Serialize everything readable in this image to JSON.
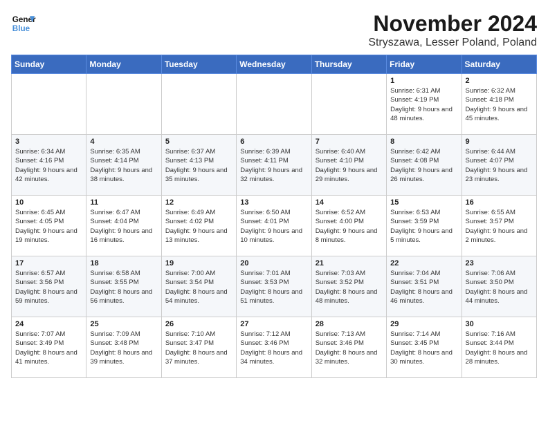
{
  "header": {
    "logo_line1": "General",
    "logo_line2": "Blue",
    "month_title": "November 2024",
    "location": "Stryszawa, Lesser Poland, Poland"
  },
  "weekdays": [
    "Sunday",
    "Monday",
    "Tuesday",
    "Wednesday",
    "Thursday",
    "Friday",
    "Saturday"
  ],
  "weeks": [
    [
      {
        "day": "",
        "content": ""
      },
      {
        "day": "",
        "content": ""
      },
      {
        "day": "",
        "content": ""
      },
      {
        "day": "",
        "content": ""
      },
      {
        "day": "",
        "content": ""
      },
      {
        "day": "1",
        "content": "Sunrise: 6:31 AM\nSunset: 4:19 PM\nDaylight: 9 hours\nand 48 minutes."
      },
      {
        "day": "2",
        "content": "Sunrise: 6:32 AM\nSunset: 4:18 PM\nDaylight: 9 hours\nand 45 minutes."
      }
    ],
    [
      {
        "day": "3",
        "content": "Sunrise: 6:34 AM\nSunset: 4:16 PM\nDaylight: 9 hours\nand 42 minutes."
      },
      {
        "day": "4",
        "content": "Sunrise: 6:35 AM\nSunset: 4:14 PM\nDaylight: 9 hours\nand 38 minutes."
      },
      {
        "day": "5",
        "content": "Sunrise: 6:37 AM\nSunset: 4:13 PM\nDaylight: 9 hours\nand 35 minutes."
      },
      {
        "day": "6",
        "content": "Sunrise: 6:39 AM\nSunset: 4:11 PM\nDaylight: 9 hours\nand 32 minutes."
      },
      {
        "day": "7",
        "content": "Sunrise: 6:40 AM\nSunset: 4:10 PM\nDaylight: 9 hours\nand 29 minutes."
      },
      {
        "day": "8",
        "content": "Sunrise: 6:42 AM\nSunset: 4:08 PM\nDaylight: 9 hours\nand 26 minutes."
      },
      {
        "day": "9",
        "content": "Sunrise: 6:44 AM\nSunset: 4:07 PM\nDaylight: 9 hours\nand 23 minutes."
      }
    ],
    [
      {
        "day": "10",
        "content": "Sunrise: 6:45 AM\nSunset: 4:05 PM\nDaylight: 9 hours\nand 19 minutes."
      },
      {
        "day": "11",
        "content": "Sunrise: 6:47 AM\nSunset: 4:04 PM\nDaylight: 9 hours\nand 16 minutes."
      },
      {
        "day": "12",
        "content": "Sunrise: 6:49 AM\nSunset: 4:02 PM\nDaylight: 9 hours\nand 13 minutes."
      },
      {
        "day": "13",
        "content": "Sunrise: 6:50 AM\nSunset: 4:01 PM\nDaylight: 9 hours\nand 10 minutes."
      },
      {
        "day": "14",
        "content": "Sunrise: 6:52 AM\nSunset: 4:00 PM\nDaylight: 9 hours\nand 8 minutes."
      },
      {
        "day": "15",
        "content": "Sunrise: 6:53 AM\nSunset: 3:59 PM\nDaylight: 9 hours\nand 5 minutes."
      },
      {
        "day": "16",
        "content": "Sunrise: 6:55 AM\nSunset: 3:57 PM\nDaylight: 9 hours\nand 2 minutes."
      }
    ],
    [
      {
        "day": "17",
        "content": "Sunrise: 6:57 AM\nSunset: 3:56 PM\nDaylight: 8 hours\nand 59 minutes."
      },
      {
        "day": "18",
        "content": "Sunrise: 6:58 AM\nSunset: 3:55 PM\nDaylight: 8 hours\nand 56 minutes."
      },
      {
        "day": "19",
        "content": "Sunrise: 7:00 AM\nSunset: 3:54 PM\nDaylight: 8 hours\nand 54 minutes."
      },
      {
        "day": "20",
        "content": "Sunrise: 7:01 AM\nSunset: 3:53 PM\nDaylight: 8 hours\nand 51 minutes."
      },
      {
        "day": "21",
        "content": "Sunrise: 7:03 AM\nSunset: 3:52 PM\nDaylight: 8 hours\nand 48 minutes."
      },
      {
        "day": "22",
        "content": "Sunrise: 7:04 AM\nSunset: 3:51 PM\nDaylight: 8 hours\nand 46 minutes."
      },
      {
        "day": "23",
        "content": "Sunrise: 7:06 AM\nSunset: 3:50 PM\nDaylight: 8 hours\nand 44 minutes."
      }
    ],
    [
      {
        "day": "24",
        "content": "Sunrise: 7:07 AM\nSunset: 3:49 PM\nDaylight: 8 hours\nand 41 minutes."
      },
      {
        "day": "25",
        "content": "Sunrise: 7:09 AM\nSunset: 3:48 PM\nDaylight: 8 hours\nand 39 minutes."
      },
      {
        "day": "26",
        "content": "Sunrise: 7:10 AM\nSunset: 3:47 PM\nDaylight: 8 hours\nand 37 minutes."
      },
      {
        "day": "27",
        "content": "Sunrise: 7:12 AM\nSunset: 3:46 PM\nDaylight: 8 hours\nand 34 minutes."
      },
      {
        "day": "28",
        "content": "Sunrise: 7:13 AM\nSunset: 3:46 PM\nDaylight: 8 hours\nand 32 minutes."
      },
      {
        "day": "29",
        "content": "Sunrise: 7:14 AM\nSunset: 3:45 PM\nDaylight: 8 hours\nand 30 minutes."
      },
      {
        "day": "30",
        "content": "Sunrise: 7:16 AM\nSunset: 3:44 PM\nDaylight: 8 hours\nand 28 minutes."
      }
    ]
  ]
}
